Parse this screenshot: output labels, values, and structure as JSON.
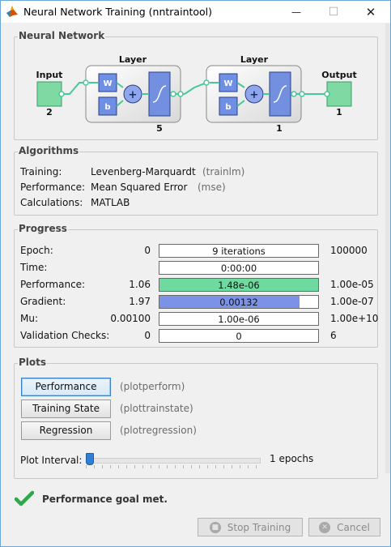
{
  "window": {
    "title": "Neural Network Training (nntraintool)",
    "controls": {
      "minimize": "—",
      "maximize": "☐",
      "close": "✕"
    }
  },
  "network": {
    "section_title": "Neural Network",
    "input_label": "Input",
    "input_size": "2",
    "layer1_label": "Layer",
    "layer1_size": "5",
    "layer2_label": "Layer",
    "layer2_size": "1",
    "output_label": "Output",
    "output_size": "1",
    "weight_label": "W",
    "bias_label": "b",
    "sum_symbol": "+"
  },
  "algorithms": {
    "section_title": "Algorithms",
    "rows": [
      {
        "label": "Training:",
        "value": "Levenberg-Marquardt",
        "code": "(trainlm)"
      },
      {
        "label": "Performance:",
        "value": "Mean Squared Error",
        "code": "(mse)"
      },
      {
        "label": "Calculations:",
        "value": "MATLAB",
        "code": ""
      }
    ]
  },
  "progress": {
    "section_title": "Progress",
    "rows": [
      {
        "label": "Epoch:",
        "start": "0",
        "current": "9 iterations",
        "end": "100000",
        "fill": 0,
        "color": ""
      },
      {
        "label": "Time:",
        "start": "",
        "current": "0:00:00",
        "end": "",
        "fill": 0,
        "color": ""
      },
      {
        "label": "Performance:",
        "start": "1.06",
        "current": "1.48e-06",
        "end": "1.00e-05",
        "fill": 1.0,
        "color": "#6fdaa0"
      },
      {
        "label": "Gradient:",
        "start": "1.97",
        "current": "0.00132",
        "end": "1.00e-07",
        "fill": 0.885,
        "color": "#7b93e6"
      },
      {
        "label": "Mu:",
        "start": "0.00100",
        "current": "1.00e-06",
        "end": "1.00e+10",
        "fill": 0,
        "color": ""
      },
      {
        "label": "Validation Checks:",
        "start": "0",
        "current": "0",
        "end": "6",
        "fill": 0,
        "color": ""
      }
    ]
  },
  "plots": {
    "section_title": "Plots",
    "buttons": [
      {
        "label": "Performance",
        "code": "(plotperform)"
      },
      {
        "label": "Training State",
        "code": "(plottrainstate)"
      },
      {
        "label": "Regression",
        "code": "(plotregression)"
      }
    ],
    "interval_label": "Plot Interval:",
    "interval_value": "1 epochs",
    "interval_level": 0
  },
  "status": {
    "message": "Performance goal met."
  },
  "footer": {
    "stop_label": "Stop Training",
    "cancel_label": "Cancel"
  },
  "colors": {
    "input_output_block": "#7fd9a3",
    "layer_block": "#7390e0",
    "weight_block": "#6f8fe4",
    "arrow": "#46c898",
    "check": "#2ea84a"
  }
}
